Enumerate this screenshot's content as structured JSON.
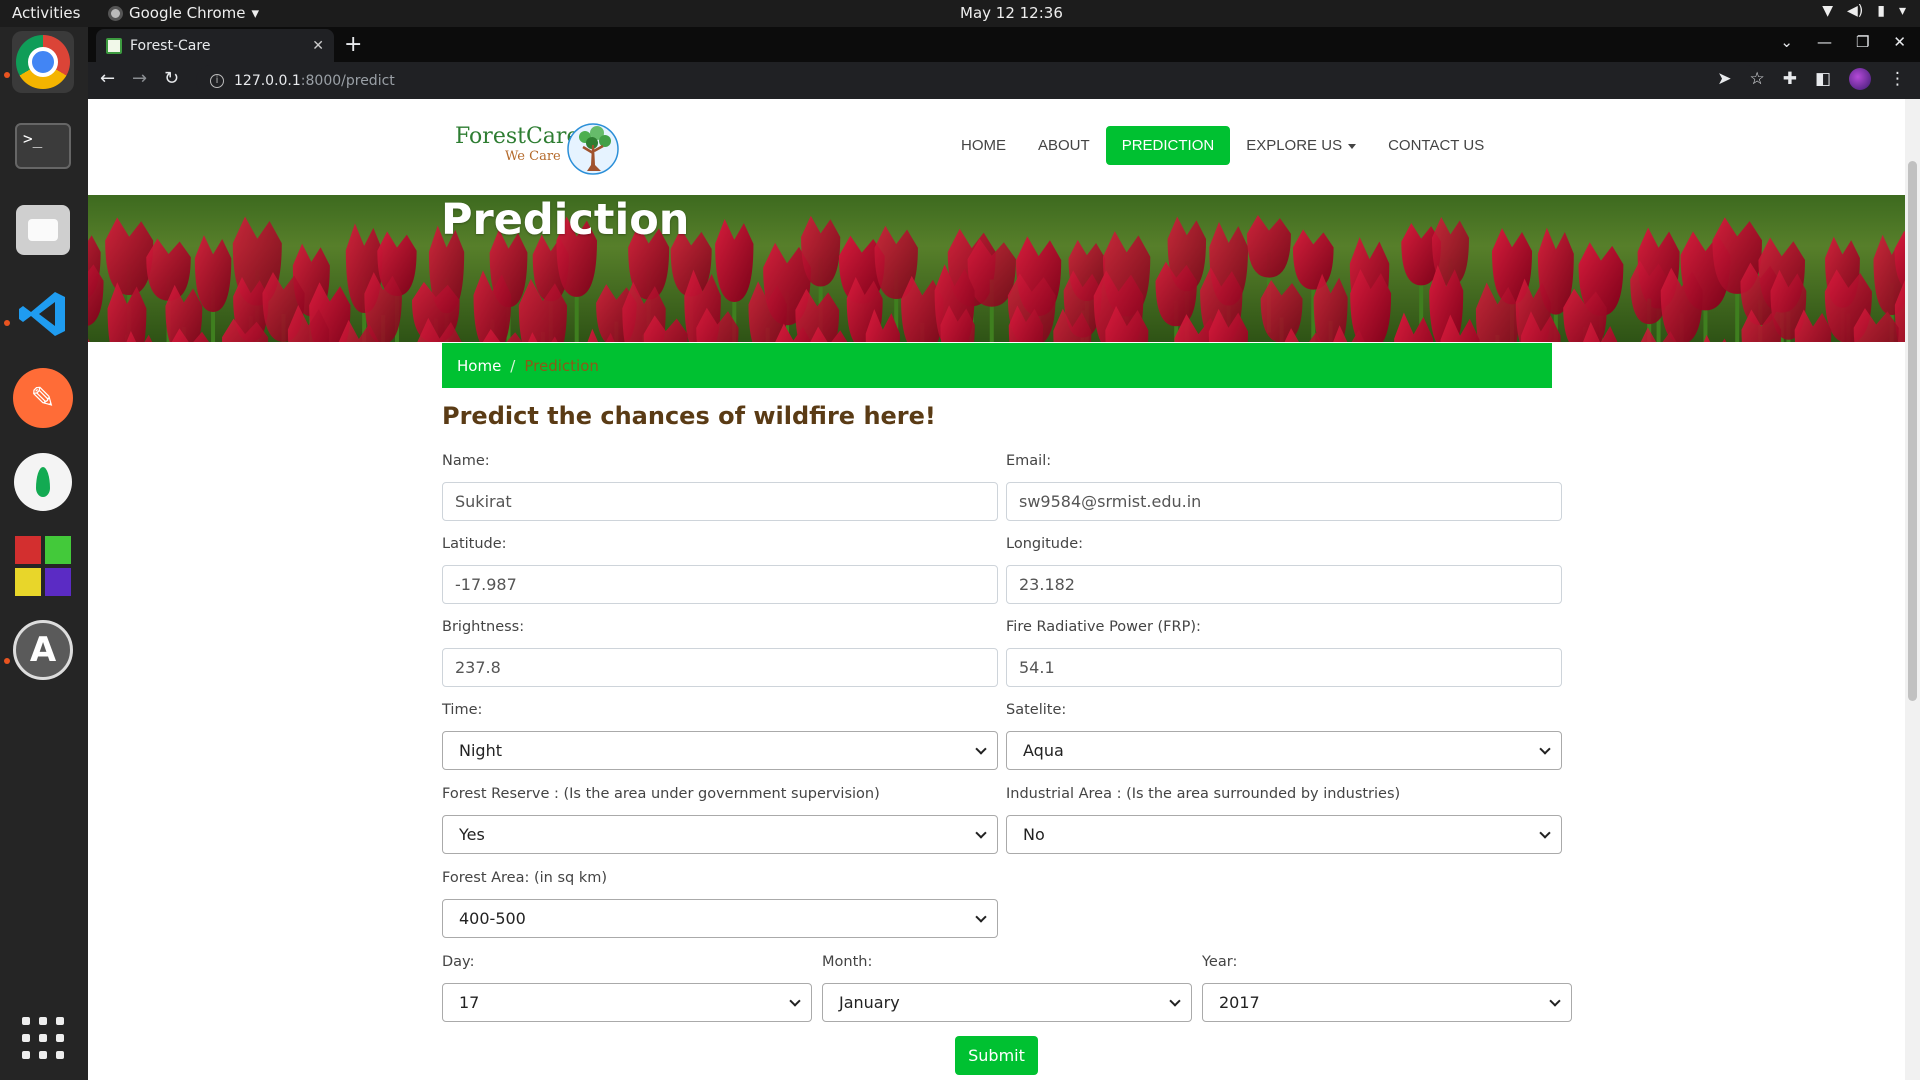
{
  "system": {
    "activities": "Activities",
    "app_name": "Google Chrome",
    "clock": "May 12  12:36"
  },
  "browser": {
    "tab_title": "Forest-Care",
    "url_host": "127.0.0.1",
    "url_path": ":8000/predict"
  },
  "site": {
    "logo_text": "ForestCare",
    "logo_sub": "We Care",
    "nav": {
      "home": "HOME",
      "about": "ABOUT",
      "prediction": "PREDICTION",
      "explore": "EXPLORE US",
      "contact": "CONTACT US"
    },
    "hero_title": "Prediction",
    "breadcrumb": {
      "home": "Home",
      "separator": "/",
      "current": "Prediction"
    }
  },
  "form": {
    "heading": "Predict the chances of wildfire here!",
    "name": {
      "label": "Name:",
      "value": "Sukirat"
    },
    "email": {
      "label": "Email:",
      "value": "sw9584@srmist.edu.in"
    },
    "latitude": {
      "label": "Latitude:",
      "value": "-17.987"
    },
    "longitude": {
      "label": "Longitude:",
      "value": "23.182"
    },
    "brightness": {
      "label": "Brightness:",
      "value": "237.8"
    },
    "frp": {
      "label": "Fire Radiative Power (FRP):",
      "value": "54.1"
    },
    "time": {
      "label": "Time:",
      "value": "Night"
    },
    "satelite": {
      "label": "Satelite:",
      "value": "Aqua"
    },
    "forest_reserve": {
      "label": "Forest Reserve : (Is the area under government supervision)",
      "value": "Yes"
    },
    "industrial_area": {
      "label": "Industrial Area : (Is the area surrounded by industries)",
      "value": "No"
    },
    "forest_area": {
      "label": "Forest Area: (in sq km)",
      "value": "400-500"
    },
    "day": {
      "label": "Day:",
      "value": "17"
    },
    "month": {
      "label": "Month:",
      "value": "January"
    },
    "year": {
      "label": "Year:",
      "value": "2017"
    },
    "submit": "Submit"
  },
  "colors": {
    "accent": "#00c131",
    "heading": "#5a3b15",
    "breadcrumb_current": "#8b5a17"
  }
}
